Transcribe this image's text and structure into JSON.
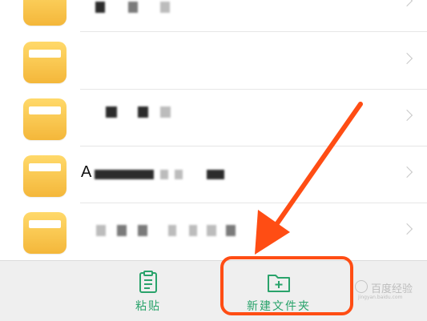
{
  "list": {
    "rows": [
      {
        "name": "folder-row-1"
      },
      {
        "name": "folder-row-2"
      },
      {
        "name": "folder-row-3"
      },
      {
        "name": "folder-row-4"
      },
      {
        "name": "folder-row-5"
      }
    ],
    "row4_visible_text": "A"
  },
  "toolbar": {
    "paste_label": "粘贴",
    "new_folder_label": "新建文件夹"
  },
  "watermark": {
    "text": "百度经验",
    "sub": "jingyan.baidu.com"
  },
  "colors": {
    "accent_green": "#2aa36b",
    "folder_yellow": "#f4b73a",
    "highlight_orange": "#ff4d14"
  },
  "icons": [
    "folder-icon",
    "chevron-right-icon",
    "clipboard-icon",
    "folder-add-icon",
    "arrow-annotation"
  ]
}
